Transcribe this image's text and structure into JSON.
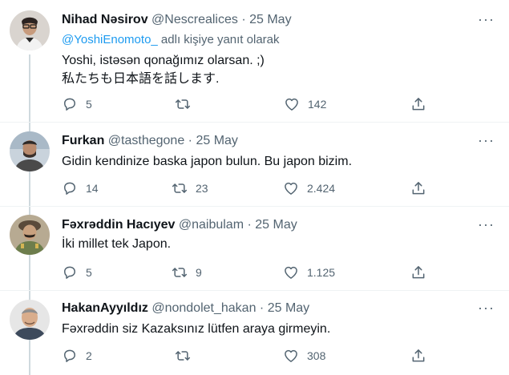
{
  "tweets": [
    {
      "name": "Nihad Nəsirov",
      "handle": "@Nescrealices",
      "dot": "·",
      "date": "25 May",
      "reply_mention": "@YoshiEnomoto_",
      "reply_suffix": " adlı kişiye yanıt olarak",
      "lines": [
        "Yoshi, istəsən qonağımız olarsan. ;)",
        "私たちも日本語を話します."
      ],
      "replies": "5",
      "retweets": "",
      "likes": "142"
    },
    {
      "name": "Furkan",
      "handle": "@tasthegone",
      "dot": "·",
      "date": "25 May",
      "lines": [
        "Gidin kendinize baska japon bulun. Bu japon bizim."
      ],
      "replies": "14",
      "retweets": "23",
      "likes": "2.424"
    },
    {
      "name": "Fəxrəddin Hacıyev",
      "handle": "@naibulam",
      "dot": "·",
      "date": "25 May",
      "lines": [
        "İki millet tek Japon."
      ],
      "replies": "5",
      "retweets": "9",
      "likes": "1.125"
    },
    {
      "name": "HakanAyyıldız",
      "handle": "@nondolet_hakan",
      "dot": "·",
      "date": "25 May",
      "lines": [
        "Fəxrəddin siz Kazaksınız lütfen araya girmeyin."
      ],
      "replies": "2",
      "retweets": "",
      "likes": "308"
    }
  ],
  "more_glyph": "···",
  "icons": {
    "reply": "reply-icon",
    "retweet": "retweet-icon",
    "like": "like-icon",
    "share": "share-icon",
    "more": "more-icon"
  },
  "colors": {
    "text": "#0f1419",
    "secondary": "#536471",
    "link": "#1d9bf0",
    "line": "#cfd9de"
  }
}
